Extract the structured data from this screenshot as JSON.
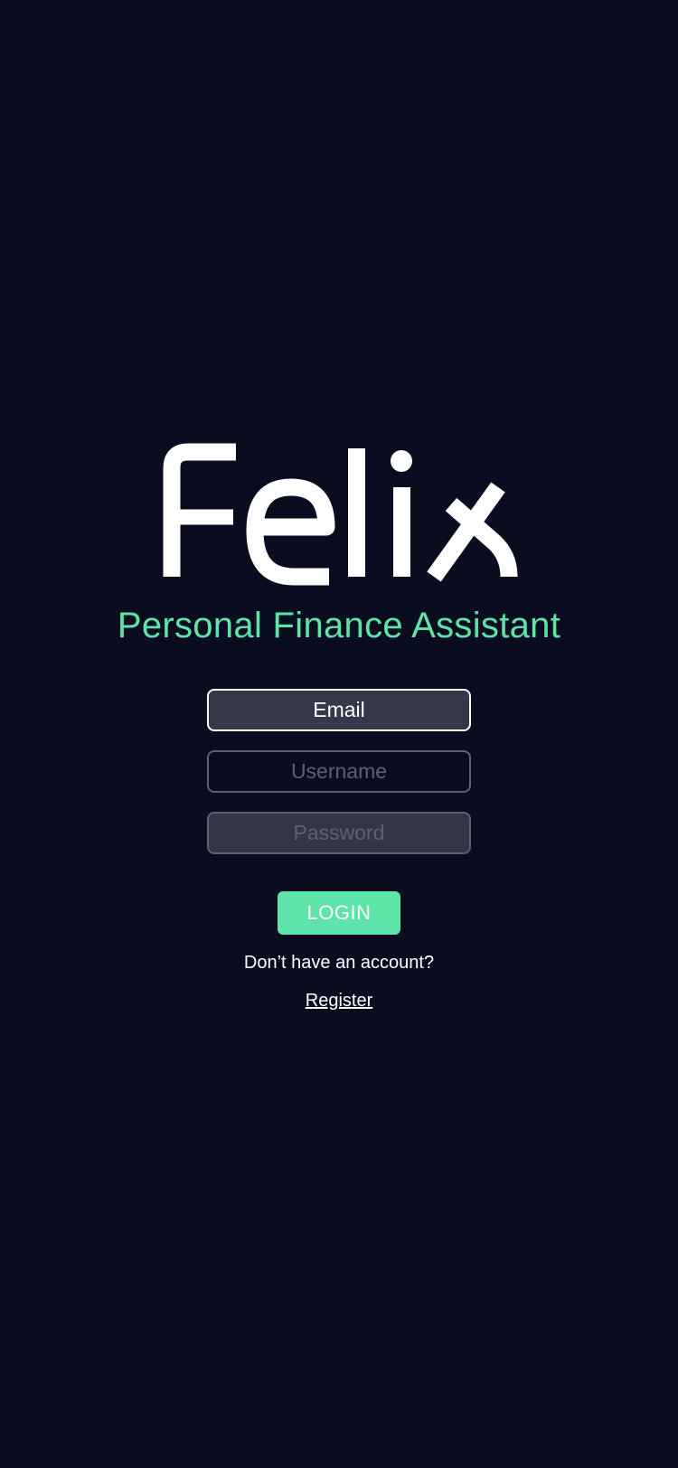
{
  "brand": {
    "logo_text": "Felix",
    "tagline": "Personal Finance Assistant"
  },
  "form": {
    "email_value": "Email",
    "username_placeholder": "Username",
    "password_placeholder": "Password",
    "login_label": "LOGIN"
  },
  "footer": {
    "prompt": "Don’t have an account?",
    "register_label": "Register"
  },
  "colors": {
    "background": "#090d1f",
    "accent": "#5ee3a8",
    "field_fill": "#353848",
    "field_border_muted": "#5d6072",
    "text": "#ffffff"
  }
}
